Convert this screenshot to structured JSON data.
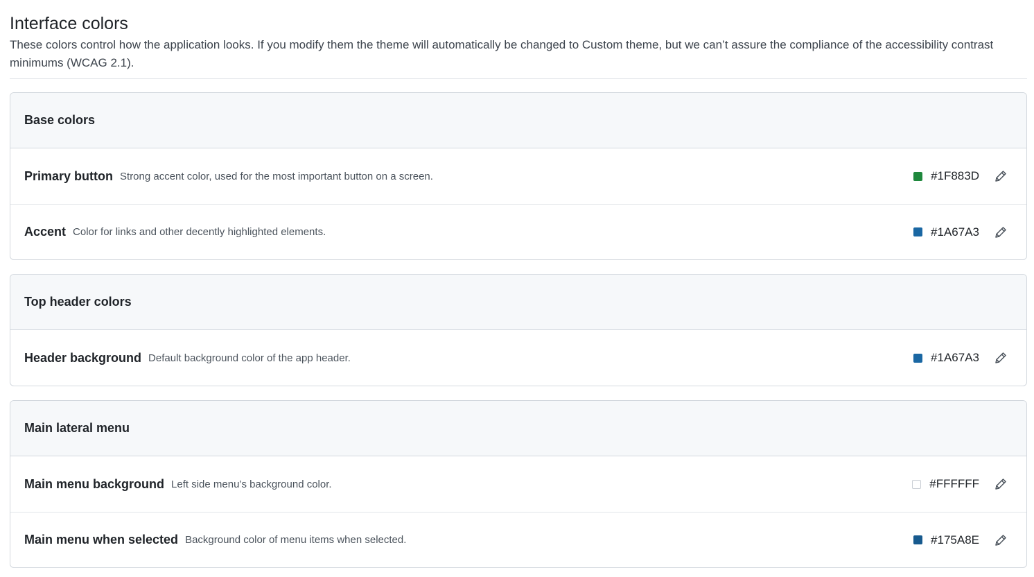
{
  "page": {
    "title": "Interface colors",
    "description": "These colors control how the application looks. If you modify them the theme will automatically be changed to Custom theme, but we can’t assure the compliance of the accessibility contrast minimums (WCAG 2.1)."
  },
  "icons": {
    "edit": "pencil-icon"
  },
  "sections": [
    {
      "title": "Base colors",
      "rows": [
        {
          "name": "Primary button",
          "description": "Strong accent color, used for the most important button on a screen.",
          "hex": "#1F883D",
          "color": "#1F883D"
        },
        {
          "name": "Accent",
          "description": "Color for links and other decently highlighted elements.",
          "hex": "#1A67A3",
          "color": "#1A67A3"
        }
      ]
    },
    {
      "title": "Top header colors",
      "rows": [
        {
          "name": "Header background",
          "description": "Default background color of the app header.",
          "hex": "#1A67A3",
          "color": "#1A67A3"
        }
      ]
    },
    {
      "title": "Main lateral menu",
      "rows": [
        {
          "name": "Main menu background",
          "description": "Left side menu’s background color.",
          "hex": "#FFFFFF",
          "color": "#FFFFFF"
        },
        {
          "name": "Main menu when selected",
          "description": "Background color of menu items when selected.",
          "hex": "#175A8E",
          "color": "#175A8E"
        }
      ]
    }
  ]
}
